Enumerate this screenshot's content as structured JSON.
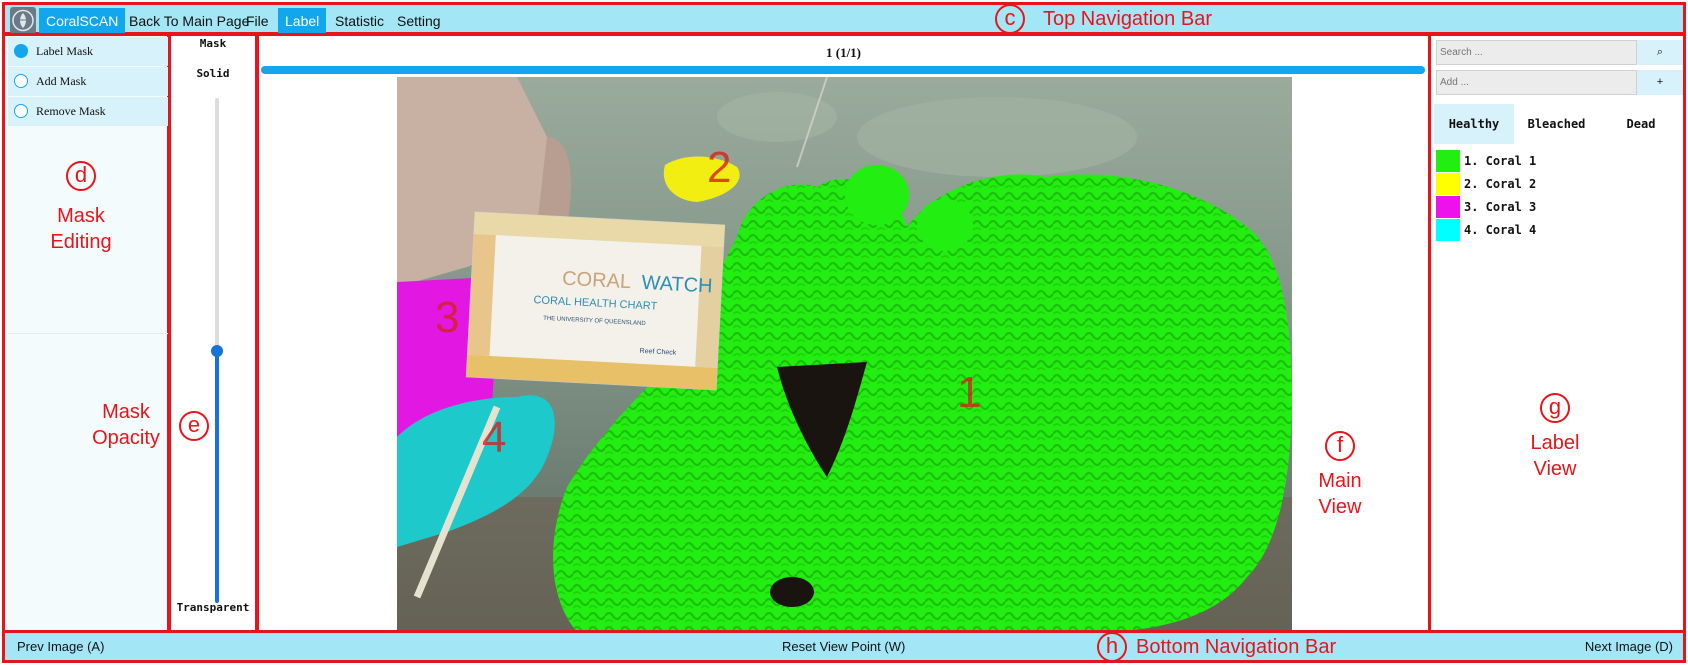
{
  "top_nav": {
    "brand": "CoralSCAN",
    "items": [
      "Back To Main Page",
      "File",
      "Label",
      "Statistic",
      "Setting"
    ],
    "active": "Label"
  },
  "mask_editing": {
    "modes": [
      {
        "label": "Label Mask",
        "selected": true
      },
      {
        "label": "Add Mask",
        "selected": false
      },
      {
        "label": "Remove Mask",
        "selected": false
      }
    ]
  },
  "opacity": {
    "title": "Mask",
    "top_label": "Solid",
    "bottom_label": "Transparent",
    "level": 0.5
  },
  "main_view": {
    "counter": "1 (1/1)",
    "region_numbers": [
      "1",
      "2",
      "3",
      "4"
    ],
    "chart_text": {
      "title_a": "CORAL",
      "title_b": "WATCH",
      "subtitle": "CORAL HEALTH CHART",
      "university": "THE UNIVERSITY OF QUEENSLAND",
      "reef_check": "Reef Check"
    }
  },
  "label_view": {
    "search_placeholder": "Search ...",
    "add_placeholder": "Add ...",
    "search_button": "⌕",
    "add_button": "+",
    "tabs": [
      "Healthy",
      "Bleached",
      "Dead"
    ],
    "active_tab": "Healthy",
    "labels": [
      {
        "text": "1. Coral 1",
        "color": "#22ee11"
      },
      {
        "text": "2. Coral 2",
        "color": "#ffff00"
      },
      {
        "text": "3. Coral 3",
        "color": "#ee11ee"
      },
      {
        "text": "4. Coral 4",
        "color": "#00ffff"
      }
    ]
  },
  "bottom_nav": {
    "prev": "Prev Image (A)",
    "reset": "Reset View Point (W)",
    "next": "Next Image (D)"
  },
  "annotations": {
    "c": "c",
    "c_text": "Top Navigation Bar",
    "d": "d",
    "d_text_1": "Mask",
    "d_text_2": "Editing",
    "e": "e",
    "e_text_1": "Mask",
    "e_text_2": "Opacity",
    "f": "f",
    "f_text_1": "Main",
    "f_text_2": "View",
    "g": "g",
    "g_text_1": "Label",
    "g_text_2": "View",
    "h": "h",
    "h_text": "Bottom Navigation Bar"
  },
  "colors": {
    "accent": "#12a6ee",
    "nav_bg": "#a3e6f6",
    "annotation_red": "#e8141b",
    "slider_blue": "#1873d9"
  }
}
